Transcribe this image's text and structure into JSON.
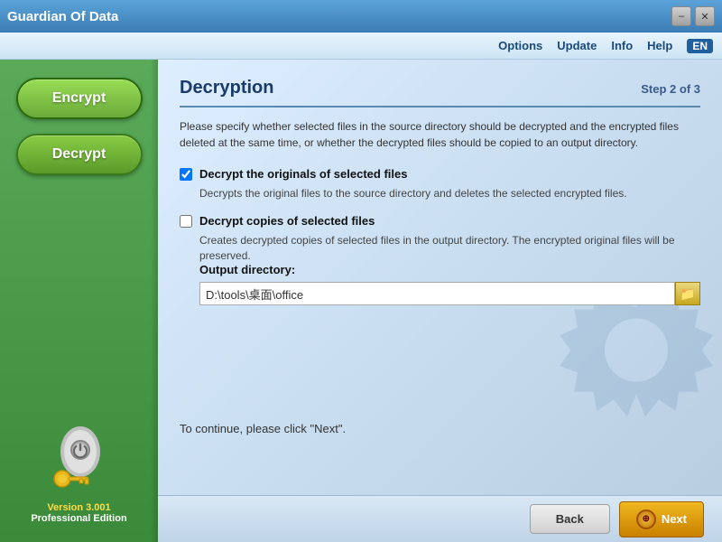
{
  "titleBar": {
    "title": "Guardian Of Data",
    "minimizeLabel": "–",
    "closeLabel": "✕"
  },
  "menuBar": {
    "items": [
      "Options",
      "Update",
      "Info",
      "Help"
    ],
    "lang": "EN"
  },
  "sidebar": {
    "encryptLabel": "Encrypt",
    "decryptLabel": "Decrypt",
    "versionLabel": "Version 3.001",
    "editionLabel": "Professional Edition"
  },
  "content": {
    "title": "Decryption",
    "stepLabel": "Step 2 of 3",
    "description": "Please specify whether selected files in the source directory should be decrypted and the encrypted files deleted at the same time, or whether the decrypted files should be copied to an output directory.",
    "option1": {
      "label": "Decrypt the originals of selected files",
      "description": "Decrypts the original files to the source directory and deletes the selected encrypted files.",
      "checked": true
    },
    "option2": {
      "label": "Decrypt copies of selected files",
      "description": "Creates decrypted copies of selected files in the output directory. The encrypted original files will be preserved.",
      "checked": false
    },
    "outputDirLabel": "Output directory:",
    "outputDirValue": "D:\\tools\\桌面\\office",
    "continueText": "To continue, please click \"Next\"."
  },
  "bottomBar": {
    "backLabel": "Back",
    "nextLabel": "Next"
  }
}
